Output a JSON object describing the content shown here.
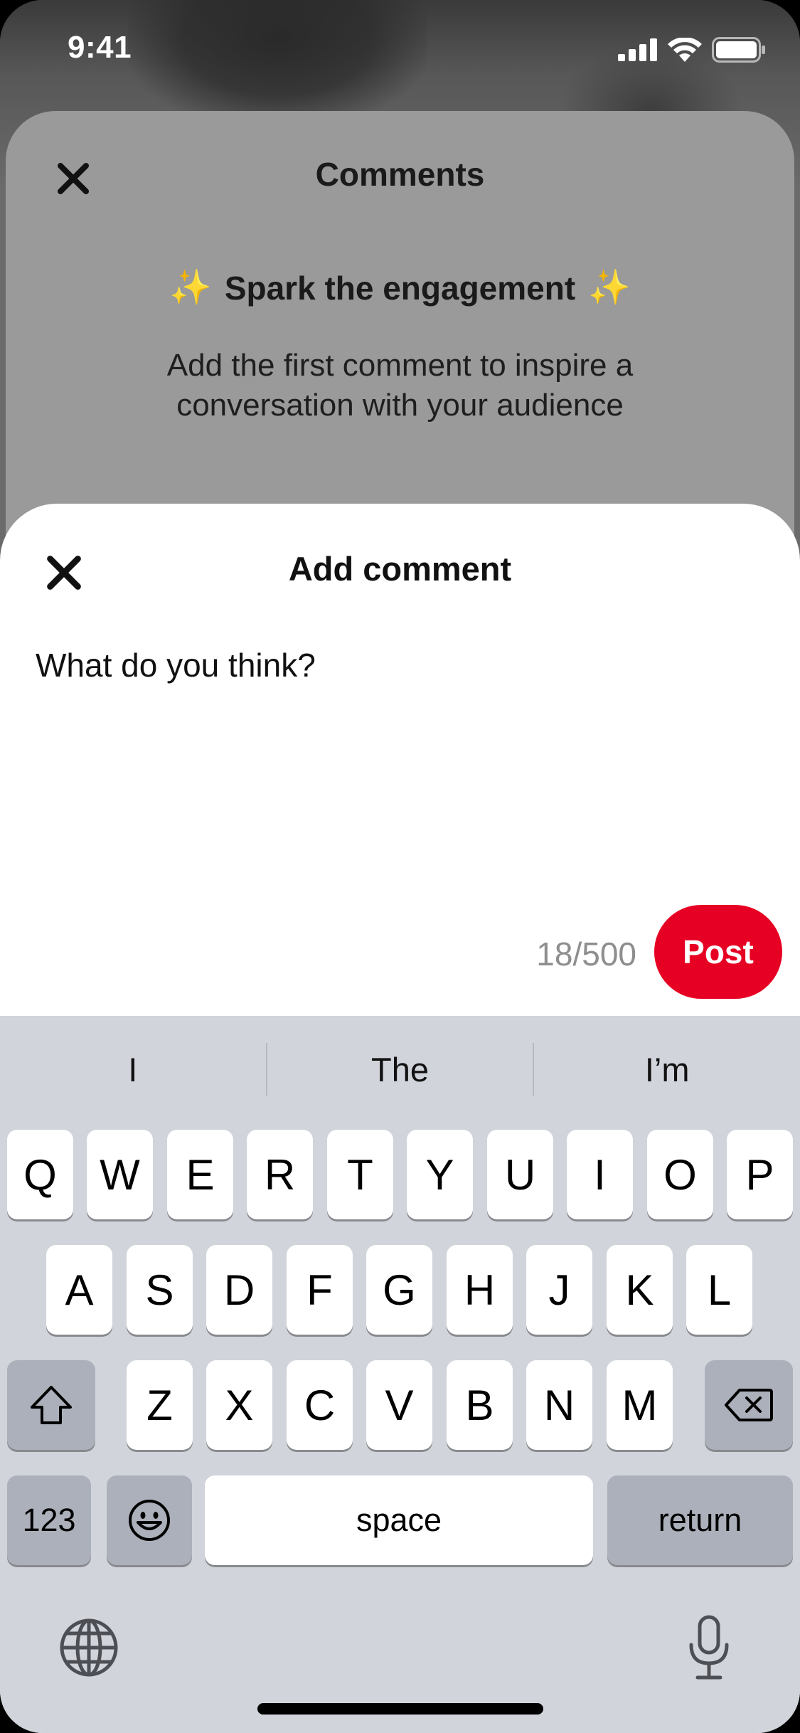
{
  "status_bar": {
    "time": "9:41"
  },
  "comments_sheet": {
    "title": "Comments",
    "spark_title": "Spark the engagement",
    "sparkle": "✨",
    "body_line1": "Add the first comment to inspire a",
    "body_line2": "conversation with your audience"
  },
  "add_comment": {
    "title": "Add comment",
    "input_placeholder": "What do you think?",
    "char_count": "18/500",
    "post_label": "Post",
    "post_color": "#e60023"
  },
  "keyboard": {
    "suggestions": [
      "I",
      "The",
      "I’m"
    ],
    "row1": [
      "Q",
      "W",
      "E",
      "R",
      "T",
      "Y",
      "U",
      "I",
      "O",
      "P"
    ],
    "row2": [
      "A",
      "S",
      "D",
      "F",
      "G",
      "H",
      "J",
      "K",
      "L"
    ],
    "row3": [
      "Z",
      "X",
      "C",
      "V",
      "B",
      "N",
      "M"
    ],
    "numbers_label": "123",
    "space_label": "space",
    "return_label": "return",
    "icons": [
      "shift-icon",
      "delete-icon",
      "emoji-icon",
      "globe-icon",
      "microphone-icon"
    ]
  }
}
